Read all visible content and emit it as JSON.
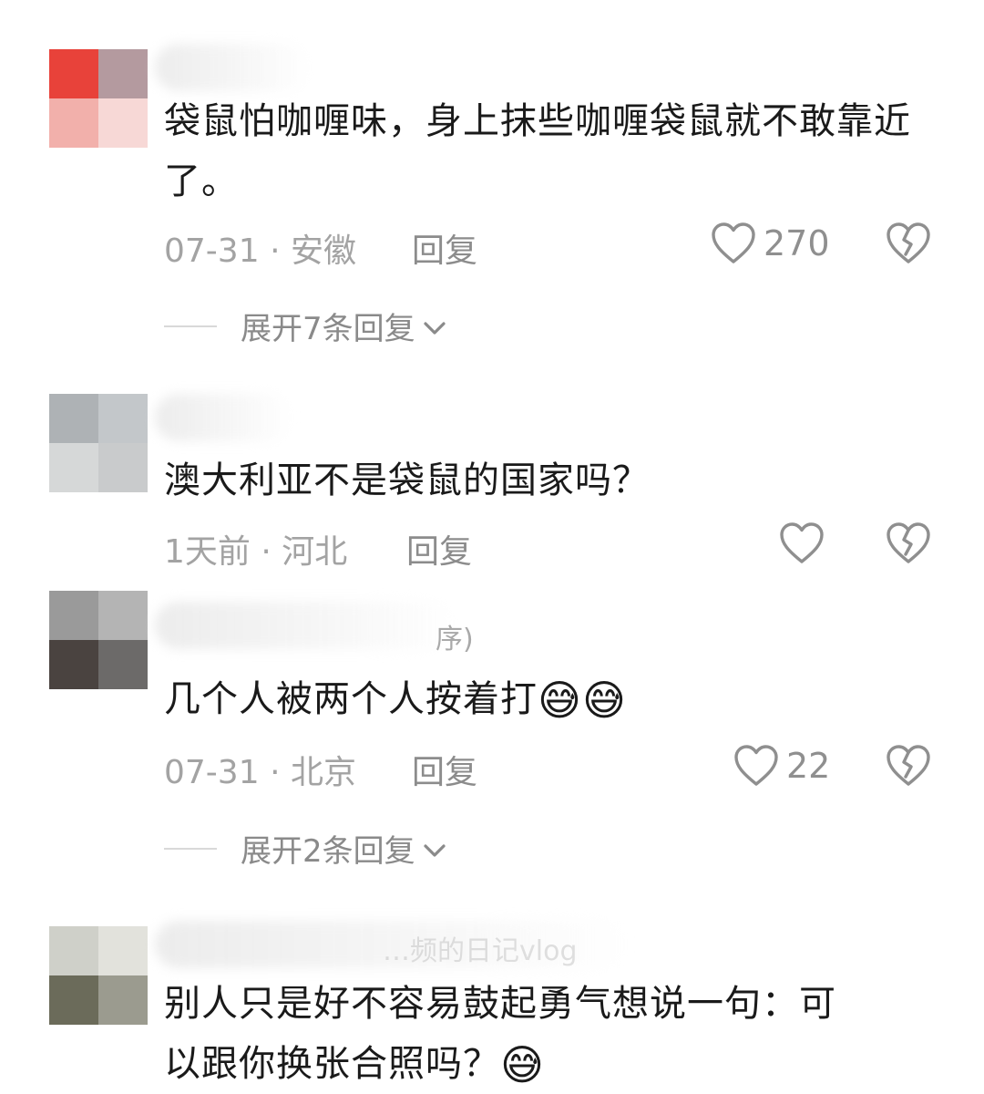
{
  "comments": [
    {
      "text": "袋鼠怕咖喱味，身上抹些咖喱袋鼠就不敢靠近了。",
      "time": "07-31",
      "location": "安徽",
      "reply_label": "回复",
      "likes": "270",
      "expand_label": "展开7条回复"
    },
    {
      "text": "澳大利亚不是袋鼠的国家吗？",
      "time": "1天前",
      "location": "河北",
      "reply_label": "回复",
      "likes": ""
    },
    {
      "name_tail": "序)",
      "text": "几个人被两个人按着打",
      "emojis": [
        "😅",
        "😅"
      ],
      "time": "07-31",
      "location": "北京",
      "reply_label": "回复",
      "likes": "22",
      "expand_label": "展开2条回复"
    },
    {
      "name_tail": "…频的日记vlog",
      "text_line1": "别人只是好不容易鼓起勇气想说一句：可",
      "text_line2": "以跟你换张合照吗？",
      "emojis": [
        "😅"
      ]
    }
  ],
  "icons": {
    "like": "heart-outline-icon",
    "dislike": "broken-heart-icon",
    "expand": "chevron-down-icon"
  },
  "colors": {
    "text": "#1a1a1a",
    "meta": "#a3a3a3",
    "reply": "#8c8c8c",
    "icon": "#8f8f8f"
  }
}
